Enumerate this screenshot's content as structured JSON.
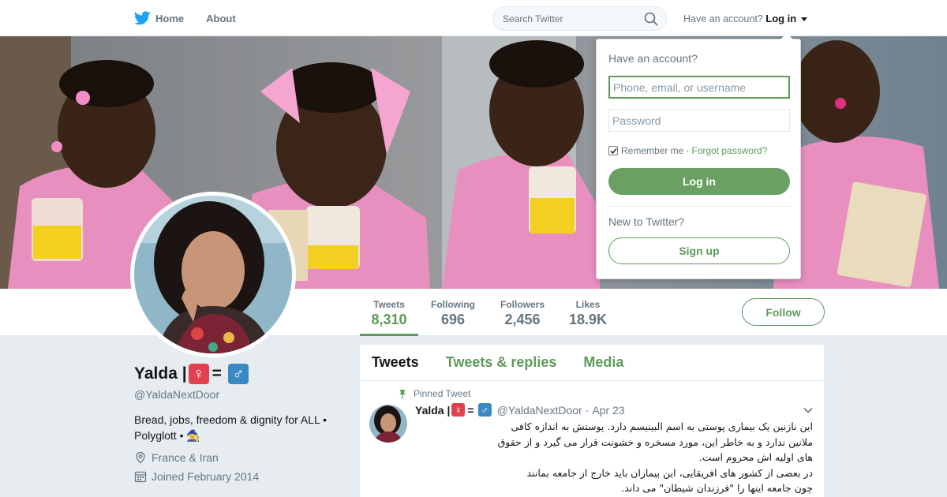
{
  "topnav": {
    "home_label": "Home",
    "about_label": "About",
    "search_placeholder": "Search Twitter",
    "have_account": "Have an account?",
    "login_label": "Log in"
  },
  "profile_nav": {
    "stats": [
      {
        "label": "Tweets",
        "value": "8,310"
      },
      {
        "label": "Following",
        "value": "696"
      },
      {
        "label": "Followers",
        "value": "2,456"
      },
      {
        "label": "Likes",
        "value": "18.9K"
      }
    ],
    "follow_label": "Follow"
  },
  "profile": {
    "name": "Yalda |",
    "female_sign": "♀",
    "equals": "=",
    "male_sign": "♂",
    "handle": "@YaldaNextDoor",
    "bio_line1": "Bread, jobs, freedom & dignity for ALL •",
    "bio_line2": "Polyglott •",
    "bio_emoji": "🧙",
    "location": "France & Iran",
    "joined": "Joined February 2014"
  },
  "timeline": {
    "tabs": [
      "Tweets",
      "Tweets & replies",
      "Media"
    ],
    "pinned_label": "Pinned Tweet",
    "tweet": {
      "name": "Yalda |",
      "handle": "@YaldaNextDoor",
      "date": "Apr 23",
      "text_lines": [
        "این نازنین یک بیماری پوستی به اسم البینیسم دارد. پوستش به اندازه کافی",
        "ملانین ندارد و به خاطر این، مورد مسخره و خشونت قرار می گیرد و از حقوق",
        "های اولیه اش محروم است.",
        "در بعضی از کشور های افریقایی، این بیماران باید خارج از جامعه بمانند",
        "چون جامعه اینها را \"فرزندان شیطان\" می داند."
      ]
    }
  },
  "login_dropdown": {
    "title": "Have an account?",
    "username_placeholder": "Phone, email, or username",
    "password_placeholder": "Password",
    "remember_label": "Remember me",
    "separator": "·",
    "forgot_label": "Forgot password?",
    "login_button": "Log in",
    "new_label": "New to Twitter?",
    "signup_button": "Sign up"
  },
  "colors": {
    "accent": "#5e9b5b",
    "twitter_blue": "#1da1f2",
    "female_box": "#e0414f",
    "male_box": "#3b88c3"
  }
}
